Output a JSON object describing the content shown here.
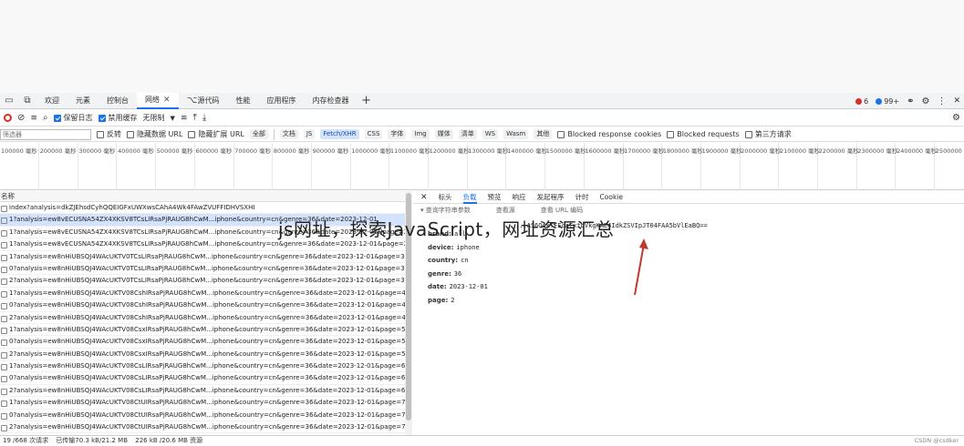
{
  "main_tabs": [
    "欢迎",
    "元素",
    "控制台",
    "网络",
    "源代码",
    "性能",
    "应用程序",
    "内存检查器"
  ],
  "active_tab_index": 3,
  "error_count": "6",
  "warning_count": "99+",
  "toolbar": {
    "preserve_log": "保留日志",
    "disable_cache": "禁用缓存",
    "throttle": "无限制"
  },
  "filter_bar": {
    "placeholder": "筛选器",
    "invert": "反转",
    "hide_data_urls": "隐藏数据 URL",
    "hide_ext_urls": "隐藏扩展 URL",
    "chips": [
      "全部",
      "文档",
      "JS",
      "Fetch/XHR",
      "CSS",
      "字体",
      "Img",
      "媒体",
      "清单",
      "WS",
      "Wasm",
      "其他"
    ],
    "active_chip": "Fetch/XHR",
    "blocked_cookies": "Blocked response cookies",
    "blocked_requests": "Blocked requests",
    "third_party": "第三方请求"
  },
  "timeline_ticks": [
    "100000 毫秒",
    "200000 毫秒",
    "300000 毫秒",
    "400000 毫秒",
    "500000 毫秒",
    "600000 毫秒",
    "700000 毫秒",
    "800000 毫秒",
    "900000 毫秒",
    "1000000 毫秒",
    "1100000 毫秒",
    "1200000 毫秒",
    "1300000 毫秒",
    "1400000 毫秒",
    "1500000 毫秒",
    "1600000 毫秒",
    "1700000 毫秒",
    "1800000 毫秒",
    "1900000 毫秒",
    "2000000 毫秒",
    "2100000 毫秒",
    "2200000 毫秒",
    "2300000 毫秒",
    "2400000 毫秒",
    "2500000 毫秒"
  ],
  "list": {
    "header": "名称",
    "rows": [
      "index?analysis=dkZJEhsdCyhQQEIGFxUWXwsCAhA4Wk4FAwZVUFFIDHVSXHI",
      "1?analysis=ew8vECUSNA54ZX4XKSV8TCsLIRsaPjRAUG8hCwM...iphone&country=cn&genre=36&date=2023-12-01",
      "1?analysis=ew8vECUSNA54ZX4XKSV8TCsLIRsaPjRAUG8hCwM...iphone&country=cn&genre=36&date=2023-12-01&page=2",
      "1?analysis=ew8vECUSNA54ZX4XKSV8TCsLIRsaPjRAUG8hCwM...iphone&country=cn&genre=36&date=2023-12-01&page=2",
      "1?analysis=ew8nHiUBSQJ4WAcUKTV0TCsLIRsaPjRAUG8hCwM...iphone&country=cn&genre=36&date=2023-12-01&page=3",
      "0?analysis=ew8nHiUBSQJ4WAcUKTV0TCsLIRsaPjRAUG8hCwM...iphone&country=cn&genre=36&date=2023-12-01&page=3",
      "2?analysis=ew8nHiUBSQJ4WAcUKTV0TCsLIRsaPjRAUG8hCwM...iphone&country=cn&genre=36&date=2023-12-01&page=3",
      "1?analysis=ew8nHiUBSQJ4WAcUKTV08CshIRsaPjRAUG8hCwM...iphone&country=cn&genre=36&date=2023-12-01&page=4",
      "0?analysis=ew8nHiUBSQJ4WAcUKTV08CshIRsaPjRAUG8hCwM...iphone&country=cn&genre=36&date=2023-12-01&page=4",
      "2?analysis=ew8nHiUBSQJ4WAcUKTV08CshIRsaPjRAUG8hCwM...iphone&country=cn&genre=36&date=2023-12-01&page=4",
      "1?analysis=ew8nHiUBSQJ4WAcUKTV08CsxIRsaPjRAUG8hCwM...iphone&country=cn&genre=36&date=2023-12-01&page=5",
      "0?analysis=ew8nHiUBSQJ4WAcUKTV08CsxIRsaPjRAUG8hCwM...iphone&country=cn&genre=36&date=2023-12-01&page=5",
      "2?analysis=ew8nHiUBSQJ4WAcUKTV08CsxIRsaPjRAUG8hCwM...iphone&country=cn&genre=36&date=2023-12-01&page=5",
      "1?analysis=ew8nHiUBSQJ4WAcUKTV08CsLIRsaPjRAUG8hCwM...iphone&country=cn&genre=36&date=2023-12-01&page=6",
      "0?analysis=ew8nHiUBSQJ4WAcUKTV08CsLIRsaPjRAUG8hCwM...iphone&country=cn&genre=36&date=2023-12-01&page=6",
      "2?analysis=ew8nHiUBSQJ4WAcUKTV08CsLIRsaPjRAUG8hCwM...iphone&country=cn&genre=36&date=2023-12-01&page=6",
      "1?analysis=ew8nHiUBSQJ4WAcUKTV08CtUIRsaPjRAUG8hCwM...iphone&country=cn&genre=36&date=2023-12-01&page=7",
      "0?analysis=ew8nHiUBSQJ4WAcUKTV08CtUIRsaPjRAUG8hCwM...iphone&country=cn&genre=36&date=2023-12-01&page=7",
      "2?analysis=ew8nHiUBSQJ4WAcUKTV08CtUIRsaPjRAUG8hCwM...iphone&country=cn&genre=36&date=2023-12-01&page=7"
    ]
  },
  "detail": {
    "tabs": [
      "标头",
      "负载",
      "预览",
      "响应",
      "发起程序",
      "计时",
      "Cookie"
    ],
    "active_tab": "负载",
    "sub": [
      "查询字符串参数",
      "查看源",
      "查看 URL 编码"
    ],
    "analysis_value": "...AS6OgkTFEcaCxtbVkgKAE4IdkZSVIpJT04FAA5bVlEaBQ==",
    "params": [
      {
        "k": "brand:",
        "v": "all"
      },
      {
        "k": "device:",
        "v": "iphone"
      },
      {
        "k": "country:",
        "v": "cn"
      },
      {
        "k": "genre:",
        "v": "36"
      },
      {
        "k": "date:",
        "v": "2023-12-01"
      },
      {
        "k": "page:",
        "v": "2"
      }
    ]
  },
  "status_bar": {
    "count": "19 /668 次请求",
    "transferred": "已传输70.3 kB/21.2 MB",
    "resources": "226 kB /20.6 MB 资源"
  },
  "overlay_text": "js网址，探索JavaScript，网址资源汇总",
  "watermark": "CSDN @csdker"
}
